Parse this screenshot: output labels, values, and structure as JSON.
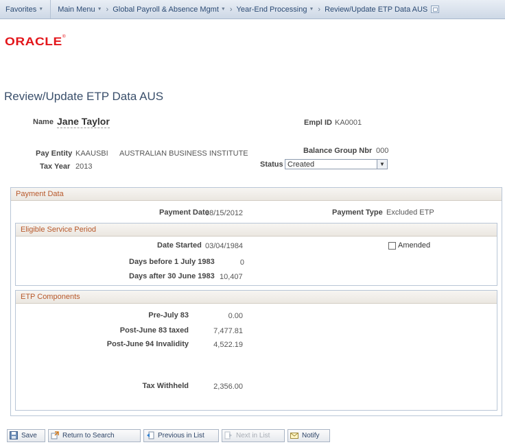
{
  "nav": {
    "favorites": "Favorites",
    "main_menu": "Main Menu",
    "crumb1": "Global Payroll & Absence Mgmt",
    "crumb2": "Year-End Processing",
    "crumb3": "Review/Update ETP Data AUS"
  },
  "brand": {
    "logo_text": "ORACLE"
  },
  "page": {
    "title": "Review/Update ETP Data AUS"
  },
  "header": {
    "name_label": "Name",
    "name_value": "Jane Taylor",
    "emplid_label": "Empl ID",
    "emplid_value": "KA0001",
    "pay_entity_label": "Pay Entity",
    "pay_entity_code": "KAAUSBI",
    "pay_entity_name": "AUSTRALIAN BUSINESS INSTITUTE",
    "balance_group_label": "Balance Group Nbr",
    "balance_group_value": "000",
    "tax_year_label": "Tax Year",
    "tax_year_value": "2013",
    "status_label": "Status",
    "status_value": "Created"
  },
  "payment": {
    "header": "Payment Data",
    "payment_date_label": "Payment Date",
    "payment_date_value": "08/15/2012",
    "payment_type_label": "Payment Type",
    "payment_type_value": "Excluded ETP"
  },
  "eligible": {
    "header": "Eligible Service Period",
    "date_started_label": "Date Started",
    "date_started_value": "03/04/1984",
    "amended_label": "Amended",
    "amended_checked": false,
    "days_before_label": "Days before 1 July 1983",
    "days_before_value": "0",
    "days_after_label": "Days after 30 June 1983",
    "days_after_value": "10,407"
  },
  "etp": {
    "header": "ETP Components",
    "pre_july_label": "Pre-July 83",
    "pre_july_value": "0.00",
    "post_june83_label": "Post-June 83 taxed",
    "post_june83_value": "7,477.81",
    "post_june94_label": "Post-June 94 Invalidity",
    "post_june94_value": "4,522.19",
    "tax_withheld_label": "Tax Withheld",
    "tax_withheld_value": "2,356.00"
  },
  "toolbar": {
    "save": "Save",
    "return": "Return to Search",
    "previous": "Previous in List",
    "next": "Next in List",
    "notify": "Notify"
  }
}
